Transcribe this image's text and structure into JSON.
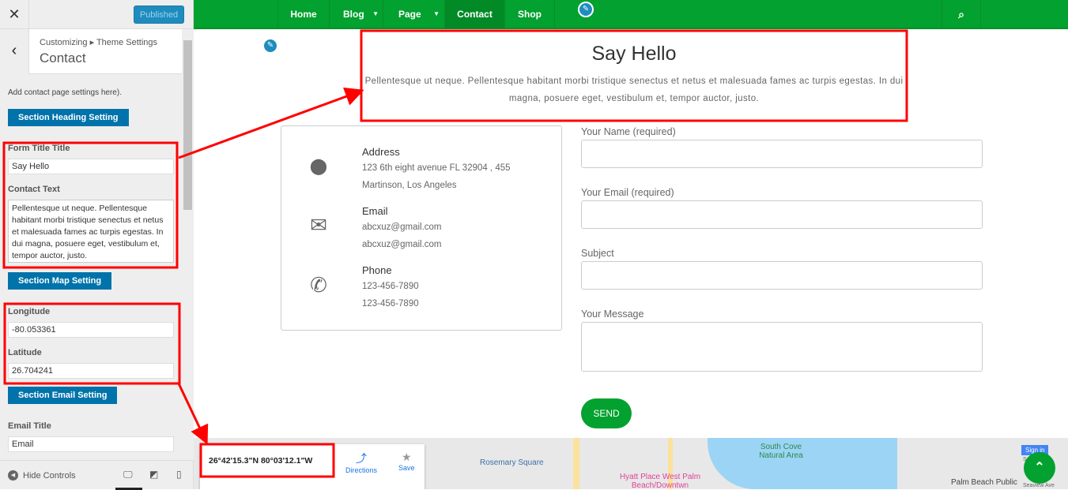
{
  "sidebar": {
    "close": "✕",
    "published": "Published",
    "back": "‹",
    "breadcrumb": "Customizing ▸ Theme Settings",
    "title": "Contact",
    "description": "Add contact page settings here).",
    "section_heading": "Section Heading Setting",
    "form_title_label": "Form Title Title",
    "form_title_value": "Say Hello",
    "contact_text_label": "Contact Text",
    "contact_text_value": "Pellentesque ut neque. Pellentesque habitant morbi tristique senectus et netus et malesuada fames ac turpis egestas. In dui magna, posuere eget, vestibulum et, tempor auctor, justo.",
    "section_map": "Section Map Setting",
    "longitude_label": "Longitude",
    "longitude_value": "-80.053361",
    "latitude_label": "Latitude",
    "latitude_value": "26.704241",
    "section_email": "Section Email Setting",
    "email_title_label": "Email Title",
    "email_title_value": "Email",
    "hide_controls": "Hide Controls"
  },
  "nav": {
    "items": [
      "Home",
      "Blog",
      "Page",
      "Contact",
      "Shop"
    ],
    "active": "Contact"
  },
  "main": {
    "heading": "Say Hello",
    "text": "Pellentesque ut neque. Pellentesque habitant morbi tristique senectus et netus et malesuada fames ac turpis egestas. In dui magna, posuere eget, vestibulum et, tempor auctor, justo.",
    "contact": [
      {
        "title": "Address",
        "lines": [
          "123 6th eight avenue FL 32904 , 455",
          "Martinson, Los Angeles"
        ]
      },
      {
        "title": "Email",
        "lines": [
          "abcxuz@gmail.com",
          "abcxuz@gmail.com"
        ]
      },
      {
        "title": "Phone",
        "lines": [
          "123-456-7890",
          "123-456-7890"
        ]
      }
    ],
    "form": {
      "name": "Your Name (required)",
      "email": "Your Email (required)",
      "subject": "Subject",
      "message": "Your Message",
      "send": "SEND"
    }
  },
  "map": {
    "coords": "26°42'15.3\"N 80°03'12.1\"W",
    "directions": "Directions",
    "save": "Save",
    "labels": [
      "Rosemary Square",
      "Hyatt Place West Palm Beach/Downtwn",
      "South Cove Natural Area",
      "Palm Beach Public",
      "Seaview Ave",
      "Seaspr"
    ],
    "sign_in": "Sign in"
  },
  "colors": {
    "nav": "#03a12f",
    "button": "#0073aa",
    "annotation": "#ff0000"
  }
}
